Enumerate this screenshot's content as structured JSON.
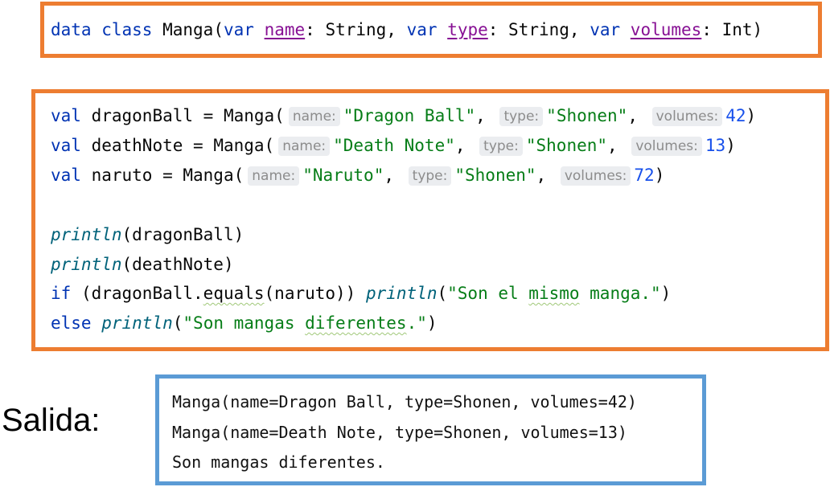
{
  "class_decl": {
    "kw_data": "data",
    "kw_class": "class",
    "class_name": "Manga",
    "open": "(",
    "kw_var": "var",
    "p1_name": "name",
    "p1_type": ": String, ",
    "p2_name": "type",
    "p2_type": ": String, ",
    "p3_name": "volumes",
    "p3_type": ": Int)"
  },
  "code": {
    "kw_val": "val",
    "lines": [
      {
        "var": "dragonBall",
        "call": " = Manga(",
        "hints": [
          "name:",
          "type:",
          "volumes:"
        ],
        "args": [
          "\"Dragon Ball\"",
          "\"Shonen\"",
          "42"
        ]
      },
      {
        "var": "deathNote",
        "call": " = Manga(",
        "hints": [
          "name:",
          "type:",
          "volumes:"
        ],
        "args": [
          "\"Death Note\"",
          "\"Shonen\"",
          "13"
        ]
      },
      {
        "var": "naruto",
        "call": " = Manga(",
        "hints": [
          "name:",
          "type:",
          "volumes:"
        ],
        "args": [
          "\"Naruto\"",
          "\"Shonen\"",
          "72"
        ]
      }
    ],
    "comma": ",",
    "close": ")",
    "println": "println",
    "print1_arg": "(dragonBall)",
    "print2_arg": "(deathNote)",
    "kw_if": "if",
    "if_cond_a": " (dragonBall.",
    "if_equals": "equals",
    "if_cond_b": "(naruto)) ",
    "if_str_a": "\"Son el ",
    "if_str_mismo": "mismo",
    "if_str_b": " manga.\"",
    "kw_else": "else",
    "else_str_a": "\"Son mangas ",
    "else_str_dif": "diferentes",
    "else_str_b": ".\""
  },
  "output": {
    "label": "Salida:",
    "lines": [
      "Manga(name=Dragon Ball, type=Shonen, volumes=42)",
      "Manga(name=Death Note, type=Shonen, volumes=13)",
      "Son mangas diferentes."
    ]
  },
  "colors": {
    "code_box_border": "#ED7D31",
    "output_box_border": "#5B9BD5",
    "keyword": "#0033B3",
    "string": "#067D17",
    "number": "#1750EB",
    "property": "#871094",
    "function": "#00627A",
    "hint_bg": "#EBEDF0",
    "hint_text": "#8C8C8C"
  }
}
